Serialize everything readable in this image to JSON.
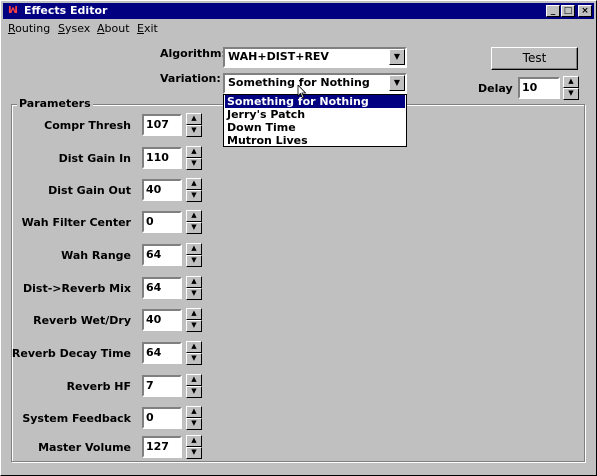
{
  "window": {
    "title": "Effects Editor",
    "app_icon": "effects-app-icon"
  },
  "titlebar_buttons": {
    "minimize": "_",
    "maximize": "□",
    "close": "×"
  },
  "menu": [
    {
      "label": "Routing",
      "underline": "R",
      "rest": "outing"
    },
    {
      "label": "Sysex",
      "underline": "S",
      "rest": "ysex"
    },
    {
      "label": "About",
      "underline": "A",
      "rest": "bout"
    },
    {
      "label": "Exit",
      "underline": "E",
      "rest": "xit"
    }
  ],
  "algorithm": {
    "label": "Algorithm:",
    "value": "WAH+DIST+REV"
  },
  "variation": {
    "label": "Variation:",
    "value": "Something for Nothing",
    "options": [
      "Something for Nothing",
      "Jerry's Patch",
      "Down Time",
      "Mutron Lives"
    ],
    "selected_index": 0
  },
  "test_button": {
    "label": "Test"
  },
  "delay": {
    "label": "Delay",
    "value": "10"
  },
  "parameters": {
    "title": "Parameters",
    "items": [
      {
        "label": "Compr Thresh",
        "value": "107"
      },
      {
        "label": "Dist Gain In",
        "value": "110"
      },
      {
        "label": "Dist Gain Out",
        "value": "40"
      },
      {
        "label": "Wah Filter Center",
        "value": "0"
      },
      {
        "label": "Wah Range",
        "value": "64"
      },
      {
        "label": "Dist->Reverb Mix",
        "value": "64"
      },
      {
        "label": "Reverb Wet/Dry",
        "value": "40"
      },
      {
        "label": "Reverb Decay Time",
        "value": "64"
      },
      {
        "label": "Reverb HF",
        "value": "7"
      },
      {
        "label": "System Feedback",
        "value": "0"
      },
      {
        "label": "Master Volume",
        "value": "127"
      }
    ]
  }
}
